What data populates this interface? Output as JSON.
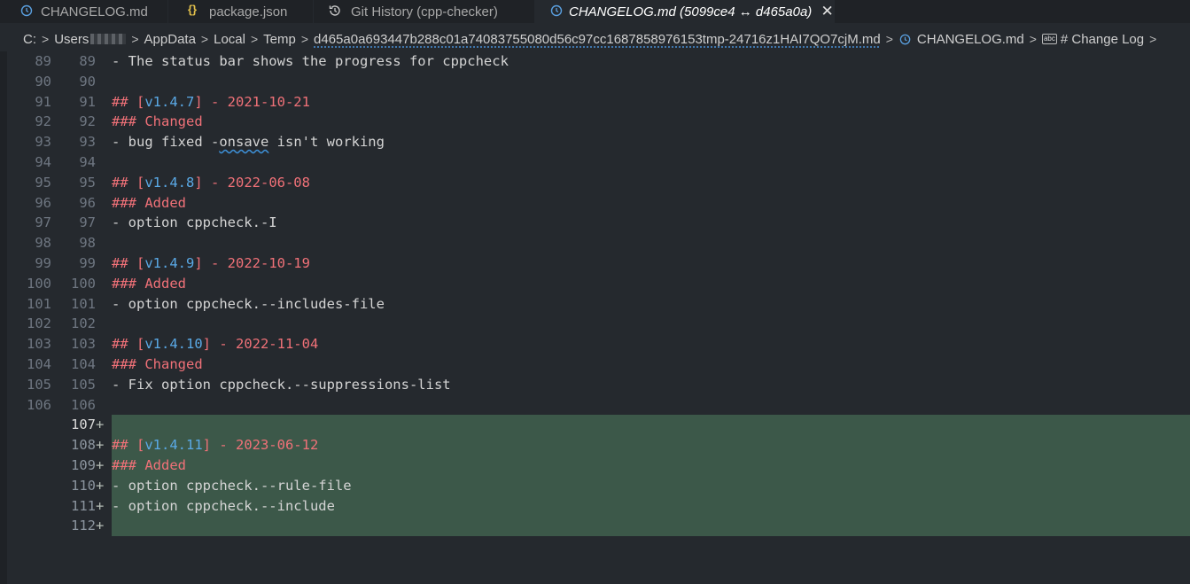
{
  "tabs": [
    {
      "label": "CHANGELOG.md",
      "icon": "history-clock-icon",
      "active": false
    },
    {
      "label": "package.json",
      "icon": "braces-icon",
      "active": false
    },
    {
      "label": "Git History (cpp-checker)",
      "icon": "git-history-icon",
      "active": false
    },
    {
      "label": "CHANGELOG.md (5099ce4 ↔ d465a0a)",
      "icon": "history-clock-icon",
      "active": true,
      "close": "✕"
    }
  ],
  "breadcrumb": {
    "drive": "C:",
    "users": "Users",
    "appdata": "AppData",
    "local": "Local",
    "temp": "Temp",
    "tmpfile": "d465a0a693447b288c01a74083755080d56c97cc1687858976153tmp-24716z1HAI7QO7cjM.md",
    "file": "CHANGELOG.md",
    "symbol": "# Change Log",
    "abc": "abc"
  },
  "lines": [
    {
      "l": "89",
      "r": "89",
      "parts": [
        [
          "- The status bar shows the progress for cppcheck",
          ""
        ]
      ]
    },
    {
      "l": "90",
      "r": "90",
      "parts": []
    },
    {
      "l": "91",
      "r": "91",
      "parts": [
        [
          "## [",
          "h"
        ],
        [
          "v1.4.7",
          "v"
        ],
        [
          "] - 2021-10-21",
          "h"
        ]
      ]
    },
    {
      "l": "92",
      "r": "92",
      "parts": [
        [
          "### Changed",
          "h"
        ]
      ]
    },
    {
      "l": "93",
      "r": "93",
      "parts": [
        [
          "- bug fixed -",
          ""
        ],
        [
          "onsave",
          "squig"
        ],
        [
          " isn't working",
          ""
        ]
      ]
    },
    {
      "l": "94",
      "r": "94",
      "parts": []
    },
    {
      "l": "95",
      "r": "95",
      "parts": [
        [
          "## [",
          "h"
        ],
        [
          "v1.4.8",
          "v"
        ],
        [
          "] - 2022-06-08",
          "h"
        ]
      ]
    },
    {
      "l": "96",
      "r": "96",
      "parts": [
        [
          "### Added",
          "h"
        ]
      ]
    },
    {
      "l": "97",
      "r": "97",
      "parts": [
        [
          "- option cppcheck.-I",
          ""
        ]
      ]
    },
    {
      "l": "98",
      "r": "98",
      "parts": []
    },
    {
      "l": "99",
      "r": "99",
      "parts": [
        [
          "## [",
          "h"
        ],
        [
          "v1.4.9",
          "v"
        ],
        [
          "] - 2022-10-19",
          "h"
        ]
      ]
    },
    {
      "l": "100",
      "r": "100",
      "parts": [
        [
          "### Added",
          "h"
        ]
      ]
    },
    {
      "l": "101",
      "r": "101",
      "parts": [
        [
          "- option cppcheck.--includes-file",
          ""
        ]
      ]
    },
    {
      "l": "102",
      "r": "102",
      "parts": []
    },
    {
      "l": "103",
      "r": "103",
      "parts": [
        [
          "## [",
          "h"
        ],
        [
          "v1.4.10",
          "v"
        ],
        [
          "] - 2022-11-04",
          "h"
        ]
      ]
    },
    {
      "l": "104",
      "r": "104",
      "parts": [
        [
          "### Changed",
          "h"
        ]
      ]
    },
    {
      "l": "105",
      "r": "105",
      "parts": [
        [
          "- Fix option cppcheck.--suppressions-list",
          ""
        ]
      ]
    },
    {
      "l": "106",
      "r": "106",
      "parts": []
    },
    {
      "l": "",
      "r": "107",
      "added": true,
      "current": true,
      "parts": []
    },
    {
      "l": "",
      "r": "108",
      "added": true,
      "parts": [
        [
          "## [",
          "h"
        ],
        [
          "v1.4.11",
          "v"
        ],
        [
          "] - 2023-06-12",
          "h"
        ]
      ]
    },
    {
      "l": "",
      "r": "109",
      "added": true,
      "parts": [
        [
          "### Added",
          "h"
        ]
      ]
    },
    {
      "l": "",
      "r": "110",
      "added": true,
      "parts": [
        [
          "- option cppcheck.--rule-file",
          ""
        ]
      ]
    },
    {
      "l": "",
      "r": "111",
      "added": true,
      "parts": [
        [
          "- option cppcheck.--include",
          ""
        ]
      ]
    },
    {
      "l": "",
      "r": "112",
      "added": true,
      "parts": []
    }
  ],
  "plus_sign": "+",
  "colors": {
    "added_bg": "#3c5849",
    "heading": "#f07178",
    "link": "#5aa9e6"
  }
}
